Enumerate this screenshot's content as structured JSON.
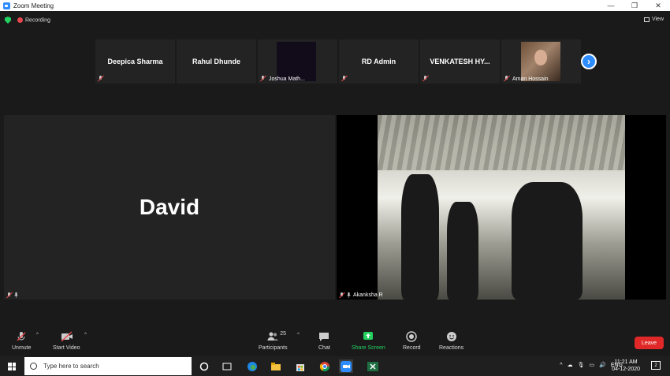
{
  "window": {
    "title": "Zoom Meeting",
    "minimize": "—",
    "maximize": "❐",
    "close": "✕"
  },
  "status": {
    "recording": "Recording",
    "view": "View"
  },
  "strip": {
    "tiles": [
      {
        "name": "Deepica Sharma"
      },
      {
        "name": "Rahul Dhunde"
      },
      {
        "name": "Joshua Math..."
      },
      {
        "name": "RD Admin"
      },
      {
        "name": "VENKATESH  HY..."
      },
      {
        "name": "Aman Hossain"
      }
    ],
    "next": "›"
  },
  "main": {
    "left_name": "David",
    "right_name": "Akanksha R"
  },
  "toolbar": {
    "unmute": "Unmute",
    "start_video": "Start Video",
    "participants": "Participants",
    "participants_count": "25",
    "chat": "Chat",
    "share_screen": "Share Screen",
    "record": "Record",
    "reactions": "Reactions",
    "leave": "Leave",
    "caret": "^"
  },
  "taskbar": {
    "search_placeholder": "Type here to search",
    "lang": "ENG",
    "time": "11:21 AM",
    "date": "04-12-2020",
    "notifications": "2"
  },
  "colors": {
    "accent": "#2D8CFF",
    "share_green": "#23d160",
    "leave_red": "#e02828"
  }
}
